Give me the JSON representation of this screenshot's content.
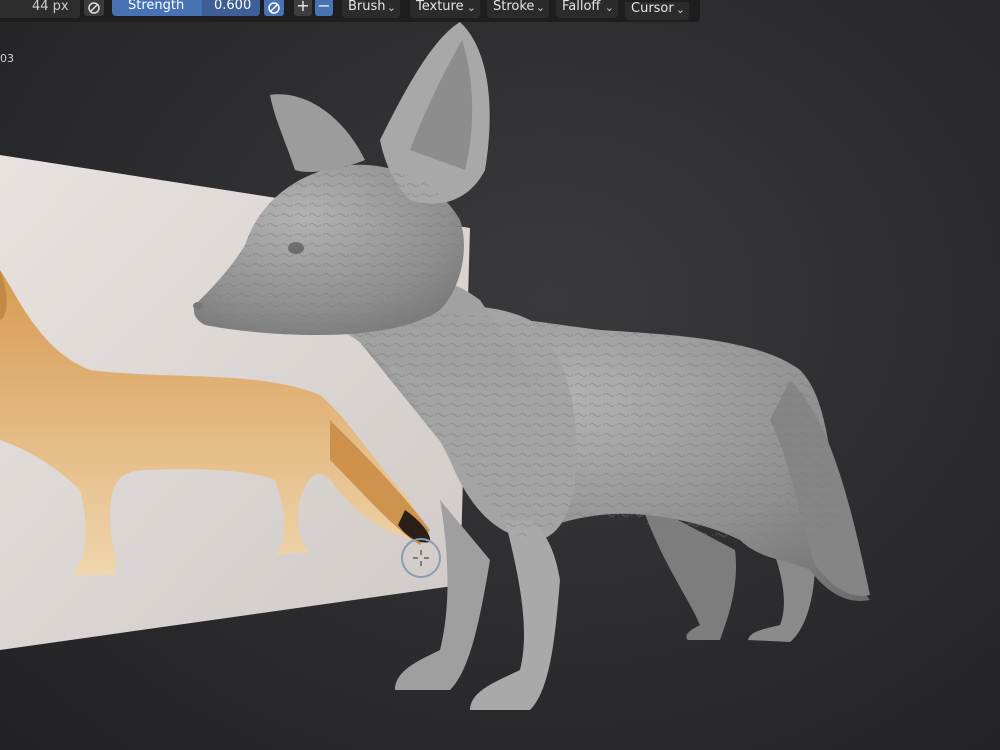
{
  "toolbar": {
    "radius_value": "44 px",
    "strength_label": "Strength",
    "strength_value": "0.600",
    "plus_label": "+",
    "minus_label": "−",
    "menus": [
      {
        "label": "Brush"
      },
      {
        "label": "Texture"
      },
      {
        "label": "Stroke"
      },
      {
        "label": "Falloff"
      },
      {
        "label": "Cursor"
      }
    ]
  },
  "viewport": {
    "corner_text": "03"
  },
  "icons": {
    "pressure": "pen-pressure-icon",
    "cursor": "sculpt-brush-cursor-icon"
  },
  "colors": {
    "accent": "#4772b3",
    "viewport_bg": "#2e2e30",
    "sculpt_clay": "#9a9a9a",
    "fox_fur": "#d9a35f"
  }
}
